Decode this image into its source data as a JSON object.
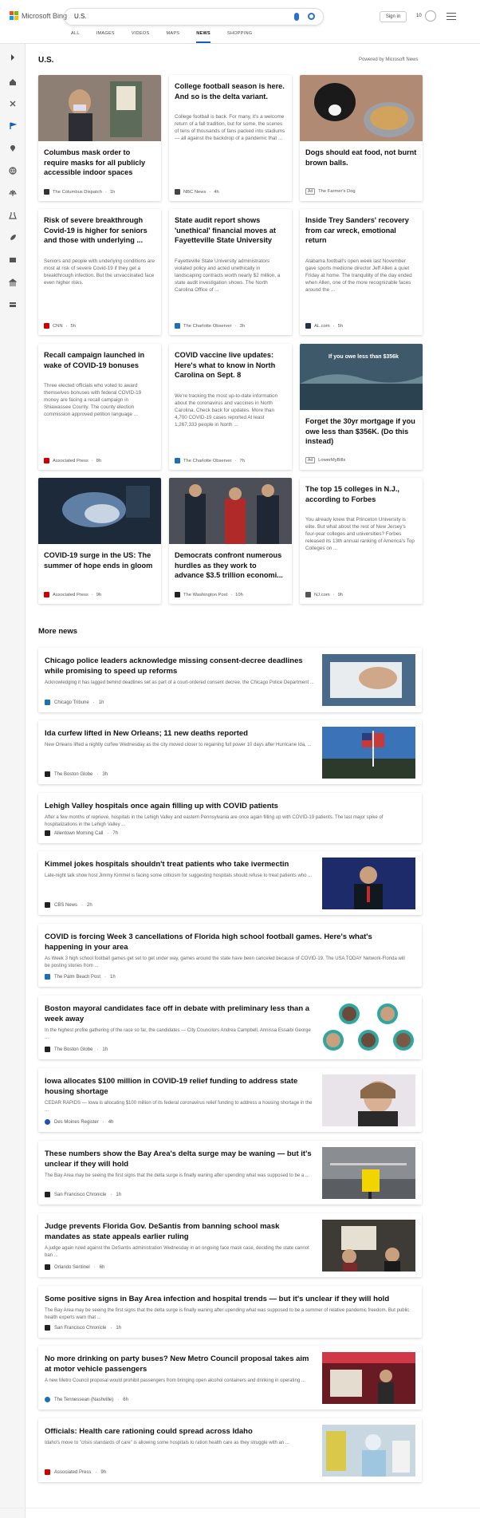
{
  "header": {
    "brand": "Microsoft Bing",
    "search_value": "U.S.",
    "signin": "Sign in",
    "points": "10"
  },
  "tabs": [
    "ALL",
    "IMAGES",
    "VIDEOS",
    "MAPS",
    "NEWS",
    "SHOPPING"
  ],
  "active_tab": "NEWS",
  "sidebar_icons": [
    "expand-icon",
    "home-icon",
    "sparkle-icon",
    "flag-icon",
    "location-icon",
    "globe-icon",
    "scale-icon",
    "beaker-icon",
    "rocket-icon",
    "film-icon",
    "bank-icon",
    "card-icon"
  ],
  "section_title": "U.S.",
  "powered_by": "Powered by Microsoft News",
  "cards": [
    {
      "title": "Columbus mask order to require masks for all publicly accessible indoor spaces",
      "desc": "",
      "source": "The Columbus Dispatch",
      "time": "1h",
      "ad": false
    },
    {
      "title": "College football season is here. And so is the delta variant.",
      "desc": "College football is back. For many, it's a welcome return of a fall tradition, but for some, the scenes of tens of thousands of fans packed into stadiums — all against the backdrop of a pandemic that ...",
      "source": "NBC News",
      "time": "4h",
      "ad": false
    },
    {
      "title": "Dogs should eat food, not burnt brown balls.",
      "desc": "",
      "source": "The Farmer's Dog",
      "time": "",
      "ad": true
    },
    {
      "title": "Risk of severe breakthrough Covid-19 is higher for seniors and those with underlying ...",
      "desc": "Seniors and people with underlying conditions are most at risk of severe Covid-19 if they get a breakthrough infection. But the unvaccinated face even higher risks.",
      "source": "CNN",
      "time": "5h",
      "ad": false
    },
    {
      "title": "State audit report shows 'unethical' financial moves at Fayetteville State University",
      "desc": "Fayetteville State University administrators violated policy and acted unethically in landscaping contracts worth nearly $2 million, a state audit investigation shows. The North Carolina Office of ...",
      "source": "The Charlotte Observer",
      "time": "3h",
      "ad": false
    },
    {
      "title": "Inside Trey Sanders' recovery from car wreck, emotional return",
      "desc": "Alabama football's open week last November gave sports medicine director Jeff Allen a quiet Friday at home. The tranquility of the day ended when Allen, one of the more recognizable faces around the ...",
      "source": "AL.com",
      "time": "5h",
      "ad": false
    },
    {
      "title": "Recall campaign launched in wake of COVID-19 bonuses",
      "desc": "Three elected officials who voted to award themselves bonuses with federal COVID-19 money are facing a recall campaign in Shiawassee County. The county election commission approved petition language ...",
      "source": "Associated Press",
      "time": "8h",
      "ad": false
    },
    {
      "title": "COVID vaccine live updates: Here's what to know in North Carolina on Sept. 8",
      "desc": "We're tracking the most up-to-date information about the coronavirus and vaccines in North Carolina. Check back for updates. More than 4,700 COVID-19 cases reported At least 1,267,333 people in North ...",
      "source": "The Charlotte Observer",
      "time": "7h",
      "ad": false
    },
    {
      "title": "Forget the 30yr mortgage if you owe less than $356K. (Do this instead)",
      "desc": "",
      "source": "LowerMyBills",
      "time": "",
      "ad": true,
      "img_text": "If you owe less than $356k"
    },
    {
      "title": "COVID-19 surge in the US: The summer of hope ends in gloom",
      "desc": "",
      "source": "Associated Press",
      "time": "9h",
      "ad": false
    },
    {
      "title": "Democrats confront numerous hurdles as they work to advance $3.5 trillion economi...",
      "desc": "",
      "source": "The Washington Post",
      "time": "10h",
      "ad": false
    },
    {
      "title": "The top 15 colleges in N.J., according to Forbes",
      "desc": "You already knew that Princeton University is elite. But what about the rest of New Jersey's four-year colleges and universities? Forbes released its 13th annual ranking of America's Top Colleges on ...",
      "source": "NJ.com",
      "time": "9h",
      "ad": false
    }
  ],
  "more_title": "More news",
  "more": [
    {
      "title": "Chicago police leaders acknowledge missing consent-decree deadlines while promising to speed up reforms",
      "desc": "Acknowledging it has lagged behind deadlines set as part of a court-ordered consent decree, the Chicago Police Department ...",
      "source": "Chicago Tribune",
      "time": "1h"
    },
    {
      "title": "Ida curfew lifted in New Orleans; 11 new deaths reported",
      "desc": "New Orleans lifted a nightly curfew Wednesday as the city moved closer to regaining full power 10 days after Hurricane Ida, ...",
      "source": "The Boston Globe",
      "time": "3h"
    },
    {
      "title": "Lehigh Valley hospitals once again filling up with COVID patients",
      "desc": "After a few months of reprieve, hospitals in the Lehigh Valley and eastern Pennsylvania are once again filling up with COVID-19 patients. The last major spike of hospitalizations in the Lehigh Valley ...",
      "source": "Allentown Morning Call",
      "time": "7h"
    },
    {
      "title": "Kimmel jokes hospitals shouldn't treat patients who take ivermectin",
      "desc": "Late-night talk show host Jimmy Kimmel is facing some criticism for suggesting hospitals should refuse to treat patients who ...",
      "source": "CBS News",
      "time": "2h"
    },
    {
      "title": "COVID is forcing Week 3 cancellations of Florida high school football games. Here's what's happening in your area",
      "desc": "As Week 3 high school football games get set to get under way, games around the state have been canceled because of COVID-19. The USA TODAY Network-Florida will be posting stories from ...",
      "source": "The Palm Beach Post",
      "time": "1h"
    },
    {
      "title": "Boston mayoral candidates face off in debate with preliminary less than a week away",
      "desc": "In the highest profile gathering of the race so far, the candidates — City Councilors Andrea Campbell, Annissa Essaibi George ...",
      "source": "The Boston Globe",
      "time": "1h"
    },
    {
      "title": "Iowa allocates $100 million in COVID-19 relief funding to address state housing shortage",
      "desc": "CEDAR RAPIDS — Iowa is allocating $100 million of its federal coronavirus relief funding to address a housing shortage in the ...",
      "source": "Des Moines Register",
      "time": "4h"
    },
    {
      "title": "These numbers show the Bay Area's delta surge may be waning — but it's unclear if they will hold",
      "desc": "The Bay Area may be seeing the first signs that the delta surge is finally waning after upending what was supposed to be a ...",
      "source": "San Francisco Chronicle",
      "time": "1h"
    },
    {
      "title": "Judge prevents Florida Gov. DeSantis from banning school mask mandates as state appeals earlier ruling",
      "desc": "A judge again ruled against the DeSantis administration Wednesday in an ongoing face mask case, deciding the state cannot ban ...",
      "source": "Orlando Sentinel",
      "time": "6h"
    },
    {
      "title": "Some positive signs in Bay Area infection and hospital trends — but it's unclear if they will hold",
      "desc": "The Bay Area may be seeing the first signs that the delta surge is finally waning after upending what was supposed to be a summer of relative pandemic freedom. But public health experts warn that ...",
      "source": "San Francisco Chronicle",
      "time": "1h"
    },
    {
      "title": "No more drinking on party buses? New Metro Council proposal takes aim at motor vehicle passengers",
      "desc": "A new Metro Council proposal would prohibit passengers from bringing open alcohol containers and drinking in operating ...",
      "source": "The Tennessean (Nashville)",
      "time": "6h"
    },
    {
      "title": "Officials: Health care rationing could spread across Idaho",
      "desc": "Idaho's move to \"crisis standards of care\" is allowing some hospitals to ration health care as they struggle with an ...",
      "source": "Associated Press",
      "time": "9h"
    }
  ]
}
